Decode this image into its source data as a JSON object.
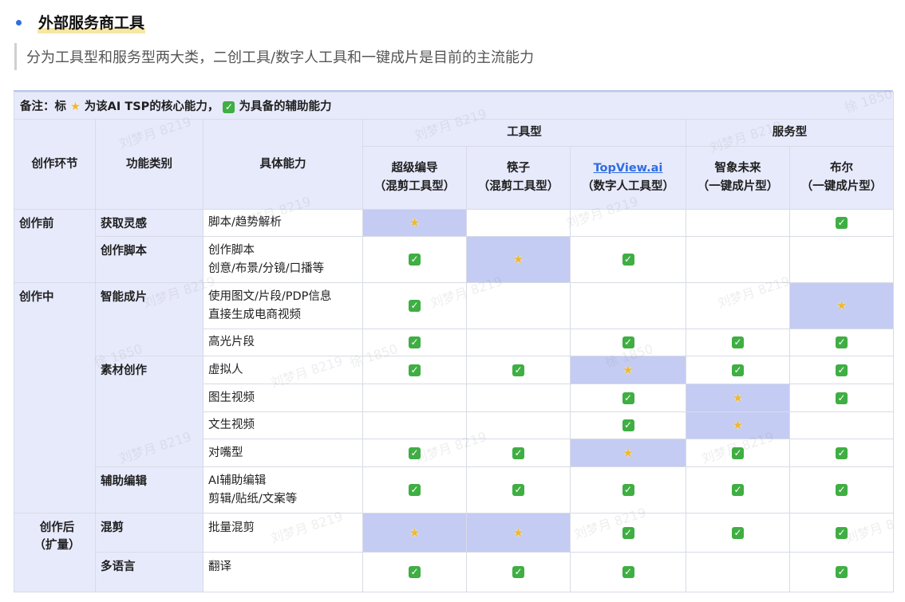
{
  "heading": "外部服务商工具",
  "quote": "分为工具型和服务型两大类，二创工具/数字人工具和一键成片是目前的主流能力",
  "note": {
    "prefix": "备注：标",
    "middle": "为该AI TSP的核心能力，",
    "suffix": "为具备的辅助能力"
  },
  "icons": {
    "core": "star-icon",
    "aux": "checkmark-icon"
  },
  "headers": {
    "stage": "创作环节",
    "category": "功能类别",
    "capability": "具体能力",
    "group_tool": "工具型",
    "group_service": "服务型",
    "vendors": [
      {
        "name": "超级编导",
        "type": "（混剪工具型）"
      },
      {
        "name": "筷子",
        "type": "（混剪工具型）"
      },
      {
        "name": "TopView.ai",
        "type": "（数字人工具型）"
      },
      {
        "name": "智象未来",
        "type": "（一键成片型）"
      },
      {
        "name": "布尔",
        "type": "（一键成片型）"
      }
    ]
  },
  "stages": {
    "pre": "创作前",
    "mid": "创作中",
    "post": "创作后",
    "post_sub": "（扩量）"
  },
  "categories": {
    "inspiration": "获取灵感",
    "script": "创作脚本",
    "smart": "智能成片",
    "material": "素材创作",
    "assist": "辅助编辑",
    "remix": "混剪",
    "multilang": "多语言"
  },
  "rows": [
    {
      "cap": [
        "脚本/趋势解析"
      ],
      "marks": [
        "star",
        "",
        "",
        "",
        "check"
      ]
    },
    {
      "cap": [
        "创作脚本",
        "创意/布景/分镜/口播等"
      ],
      "marks": [
        "check",
        "star",
        "check",
        "",
        ""
      ]
    },
    {
      "cap": [
        "使用图文/片段/PDP信息",
        "直接生成电商视频"
      ],
      "marks": [
        "check",
        "",
        "",
        "",
        "star"
      ]
    },
    {
      "cap": [
        "高光片段"
      ],
      "marks": [
        "check",
        "",
        "check",
        "check",
        "check"
      ]
    },
    {
      "cap": [
        "虚拟人"
      ],
      "marks": [
        "check",
        "check",
        "star",
        "check",
        "check"
      ]
    },
    {
      "cap": [
        "图生视频"
      ],
      "marks": [
        "",
        "",
        "check",
        "star",
        "check"
      ]
    },
    {
      "cap": [
        "文生视频"
      ],
      "marks": [
        "",
        "",
        "check",
        "star",
        ""
      ]
    },
    {
      "cap": [
        "对嘴型"
      ],
      "marks": [
        "check",
        "check",
        "star",
        "check",
        "check"
      ]
    },
    {
      "cap": [
        "AI辅助编辑",
        "剪辑/贴纸/文案等"
      ],
      "marks": [
        "check",
        "check",
        "check",
        "check",
        "check"
      ]
    },
    {
      "cap": [
        "批量混剪"
      ],
      "marks": [
        "star",
        "star",
        "check",
        "check",
        "check"
      ]
    },
    {
      "cap": [
        "翻译"
      ],
      "marks": [
        "check",
        "check",
        "check",
        "",
        "check"
      ]
    }
  ],
  "watermark": [
    "刘梦月 8219",
    "徐 1850"
  ],
  "colors": {
    "header_bg": "#e7eafb",
    "highlight_bg": "#c4ccf3",
    "check": "#3fae43",
    "star": "#efb832",
    "link": "#2f6de1"
  }
}
